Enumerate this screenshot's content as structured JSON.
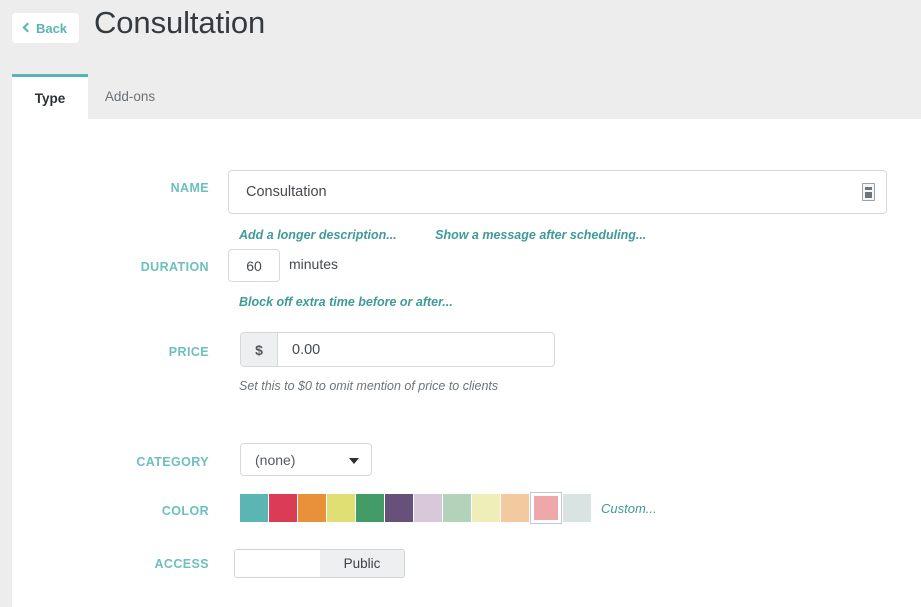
{
  "header": {
    "back_label": "Back",
    "title": "Consultation",
    "back_icon": "chevron-left-icon"
  },
  "tabs": [
    {
      "label": "Type",
      "active": true
    },
    {
      "label": "Add-ons",
      "active": false
    }
  ],
  "form": {
    "name": {
      "label": "NAME",
      "value": "Consultation",
      "placeholder": "",
      "icon": "card-glyph-icon",
      "links": [
        "Add a longer description...",
        "Show a message after scheduling..."
      ]
    },
    "duration": {
      "label": "DURATION",
      "value": "60",
      "unit": "minutes",
      "link": "Block off extra time before or after..."
    },
    "price": {
      "label": "PRICE",
      "currency_symbol": "$",
      "value": "0.00",
      "placeholder": "0.00",
      "hint": "Set this to $0 to omit mention of price to clients"
    },
    "category": {
      "label": "CATEGORY",
      "selected": "(none)",
      "options": [
        "(none)"
      ]
    },
    "color": {
      "label": "COLOR",
      "custom_label": "Custom...",
      "selected_index": 10,
      "swatches": [
        "#5bb5b2",
        "#d93c54",
        "#e9903b",
        "#dfdf74",
        "#439b68",
        "#675079",
        "#d8c8da",
        "#b3d2ba",
        "#efeeb9",
        "#f3caa0",
        "#eea7ab",
        "#d8e3e2"
      ]
    },
    "access": {
      "label": "ACCESS",
      "state_label": "Public"
    }
  },
  "theme": {
    "accent": "#57b5b2",
    "label_color": "#6cc0bd",
    "link_color": "#3f9a98",
    "page_bg": "#ededed",
    "content_bg": "#ffffff"
  }
}
